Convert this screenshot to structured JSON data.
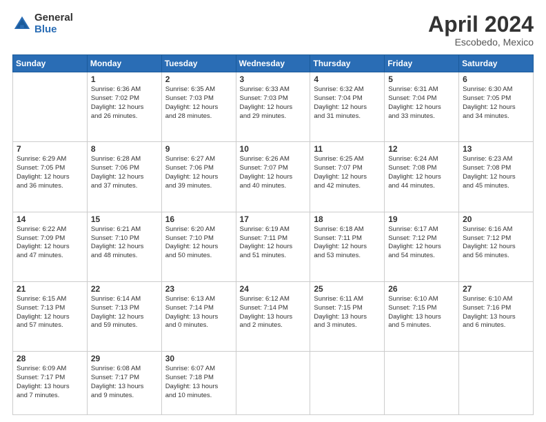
{
  "header": {
    "logo_general": "General",
    "logo_blue": "Blue",
    "month_title": "April 2024",
    "subtitle": "Escobedo, Mexico"
  },
  "days_of_week": [
    "Sunday",
    "Monday",
    "Tuesday",
    "Wednesday",
    "Thursday",
    "Friday",
    "Saturday"
  ],
  "weeks": [
    [
      {
        "day": "",
        "info": ""
      },
      {
        "day": "1",
        "info": "Sunrise: 6:36 AM\nSunset: 7:02 PM\nDaylight: 12 hours\nand 26 minutes."
      },
      {
        "day": "2",
        "info": "Sunrise: 6:35 AM\nSunset: 7:03 PM\nDaylight: 12 hours\nand 28 minutes."
      },
      {
        "day": "3",
        "info": "Sunrise: 6:33 AM\nSunset: 7:03 PM\nDaylight: 12 hours\nand 29 minutes."
      },
      {
        "day": "4",
        "info": "Sunrise: 6:32 AM\nSunset: 7:04 PM\nDaylight: 12 hours\nand 31 minutes."
      },
      {
        "day": "5",
        "info": "Sunrise: 6:31 AM\nSunset: 7:04 PM\nDaylight: 12 hours\nand 33 minutes."
      },
      {
        "day": "6",
        "info": "Sunrise: 6:30 AM\nSunset: 7:05 PM\nDaylight: 12 hours\nand 34 minutes."
      }
    ],
    [
      {
        "day": "7",
        "info": "Sunrise: 6:29 AM\nSunset: 7:05 PM\nDaylight: 12 hours\nand 36 minutes."
      },
      {
        "day": "8",
        "info": "Sunrise: 6:28 AM\nSunset: 7:06 PM\nDaylight: 12 hours\nand 37 minutes."
      },
      {
        "day": "9",
        "info": "Sunrise: 6:27 AM\nSunset: 7:06 PM\nDaylight: 12 hours\nand 39 minutes."
      },
      {
        "day": "10",
        "info": "Sunrise: 6:26 AM\nSunset: 7:07 PM\nDaylight: 12 hours\nand 40 minutes."
      },
      {
        "day": "11",
        "info": "Sunrise: 6:25 AM\nSunset: 7:07 PM\nDaylight: 12 hours\nand 42 minutes."
      },
      {
        "day": "12",
        "info": "Sunrise: 6:24 AM\nSunset: 7:08 PM\nDaylight: 12 hours\nand 44 minutes."
      },
      {
        "day": "13",
        "info": "Sunrise: 6:23 AM\nSunset: 7:08 PM\nDaylight: 12 hours\nand 45 minutes."
      }
    ],
    [
      {
        "day": "14",
        "info": "Sunrise: 6:22 AM\nSunset: 7:09 PM\nDaylight: 12 hours\nand 47 minutes."
      },
      {
        "day": "15",
        "info": "Sunrise: 6:21 AM\nSunset: 7:10 PM\nDaylight: 12 hours\nand 48 minutes."
      },
      {
        "day": "16",
        "info": "Sunrise: 6:20 AM\nSunset: 7:10 PM\nDaylight: 12 hours\nand 50 minutes."
      },
      {
        "day": "17",
        "info": "Sunrise: 6:19 AM\nSunset: 7:11 PM\nDaylight: 12 hours\nand 51 minutes."
      },
      {
        "day": "18",
        "info": "Sunrise: 6:18 AM\nSunset: 7:11 PM\nDaylight: 12 hours\nand 53 minutes."
      },
      {
        "day": "19",
        "info": "Sunrise: 6:17 AM\nSunset: 7:12 PM\nDaylight: 12 hours\nand 54 minutes."
      },
      {
        "day": "20",
        "info": "Sunrise: 6:16 AM\nSunset: 7:12 PM\nDaylight: 12 hours\nand 56 minutes."
      }
    ],
    [
      {
        "day": "21",
        "info": "Sunrise: 6:15 AM\nSunset: 7:13 PM\nDaylight: 12 hours\nand 57 minutes."
      },
      {
        "day": "22",
        "info": "Sunrise: 6:14 AM\nSunset: 7:13 PM\nDaylight: 12 hours\nand 59 minutes."
      },
      {
        "day": "23",
        "info": "Sunrise: 6:13 AM\nSunset: 7:14 PM\nDaylight: 13 hours\nand 0 minutes."
      },
      {
        "day": "24",
        "info": "Sunrise: 6:12 AM\nSunset: 7:14 PM\nDaylight: 13 hours\nand 2 minutes."
      },
      {
        "day": "25",
        "info": "Sunrise: 6:11 AM\nSunset: 7:15 PM\nDaylight: 13 hours\nand 3 minutes."
      },
      {
        "day": "26",
        "info": "Sunrise: 6:10 AM\nSunset: 7:15 PM\nDaylight: 13 hours\nand 5 minutes."
      },
      {
        "day": "27",
        "info": "Sunrise: 6:10 AM\nSunset: 7:16 PM\nDaylight: 13 hours\nand 6 minutes."
      }
    ],
    [
      {
        "day": "28",
        "info": "Sunrise: 6:09 AM\nSunset: 7:17 PM\nDaylight: 13 hours\nand 7 minutes."
      },
      {
        "day": "29",
        "info": "Sunrise: 6:08 AM\nSunset: 7:17 PM\nDaylight: 13 hours\nand 9 minutes."
      },
      {
        "day": "30",
        "info": "Sunrise: 6:07 AM\nSunset: 7:18 PM\nDaylight: 13 hours\nand 10 minutes."
      },
      {
        "day": "",
        "info": ""
      },
      {
        "day": "",
        "info": ""
      },
      {
        "day": "",
        "info": ""
      },
      {
        "day": "",
        "info": ""
      }
    ]
  ]
}
